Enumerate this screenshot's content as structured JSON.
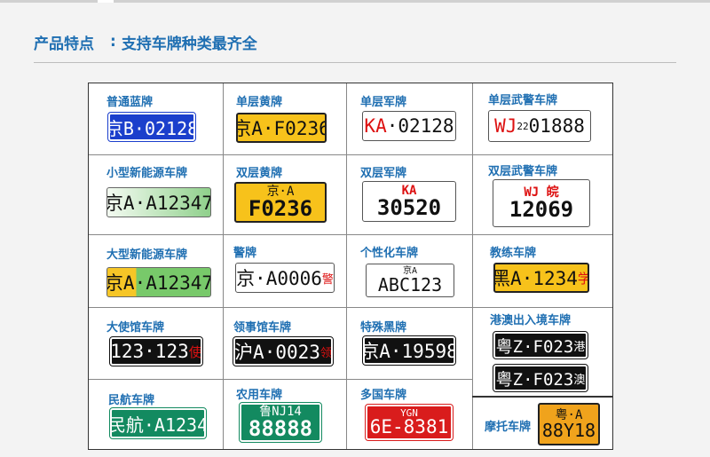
{
  "header": {
    "title": "产品特点",
    "separator": ":",
    "subtitle": "支持车牌种类最齐全"
  },
  "plates": [
    {
      "label": "普通蓝牌",
      "text": "京B·02128"
    },
    {
      "label": "单层黄牌",
      "text": "京A·F0236"
    },
    {
      "label": "单层军牌",
      "prefix": "KA",
      "text": "·02128"
    },
    {
      "label": "单层武警车牌",
      "prefix": "WJ",
      "mid": "22",
      "text": "01888"
    },
    {
      "label": "小型新能源车牌",
      "text": "京A·A12347"
    },
    {
      "label": "双层黄牌",
      "line1": "京·A",
      "line2": "F0236"
    },
    {
      "label": "双层军牌",
      "line1": "KA",
      "line2": "30520"
    },
    {
      "label": "双层武警车牌",
      "line1a": "WJ",
      "line1b": "皖",
      "line2": "12069"
    },
    {
      "label": "大型新能源车牌",
      "text": "京A·A12347"
    },
    {
      "label": "警牌",
      "text": "京·A0006",
      "suffix": "警"
    },
    {
      "label": "个性化车牌",
      "line1": "京A",
      "text": "ABC123"
    },
    {
      "label": "教练车牌",
      "text": "黑A·1234",
      "suffix": "学"
    },
    {
      "label": "大使馆车牌",
      "text": "123·123",
      "suffix": "使"
    },
    {
      "label": "领事馆车牌",
      "text": "沪A·0023",
      "suffix": "领"
    },
    {
      "label": "特殊黑牌",
      "text": "京A·19598"
    },
    {
      "label": "港澳出入境车牌",
      "text": "粤Z·F023",
      "suffix": "港",
      "text2": "粤Z·F023",
      "suffix2": "澳"
    },
    {
      "label": "民航车牌",
      "text": "民航·A1234"
    },
    {
      "label": "农用车牌",
      "line1": "鲁NJ14",
      "line2": "88888"
    },
    {
      "label": "多国车牌",
      "line1": "YGN",
      "line2": "6E-8381"
    },
    {
      "label": "摩托车牌",
      "line1": "粤·A",
      "line2": "88Y18"
    }
  ]
}
